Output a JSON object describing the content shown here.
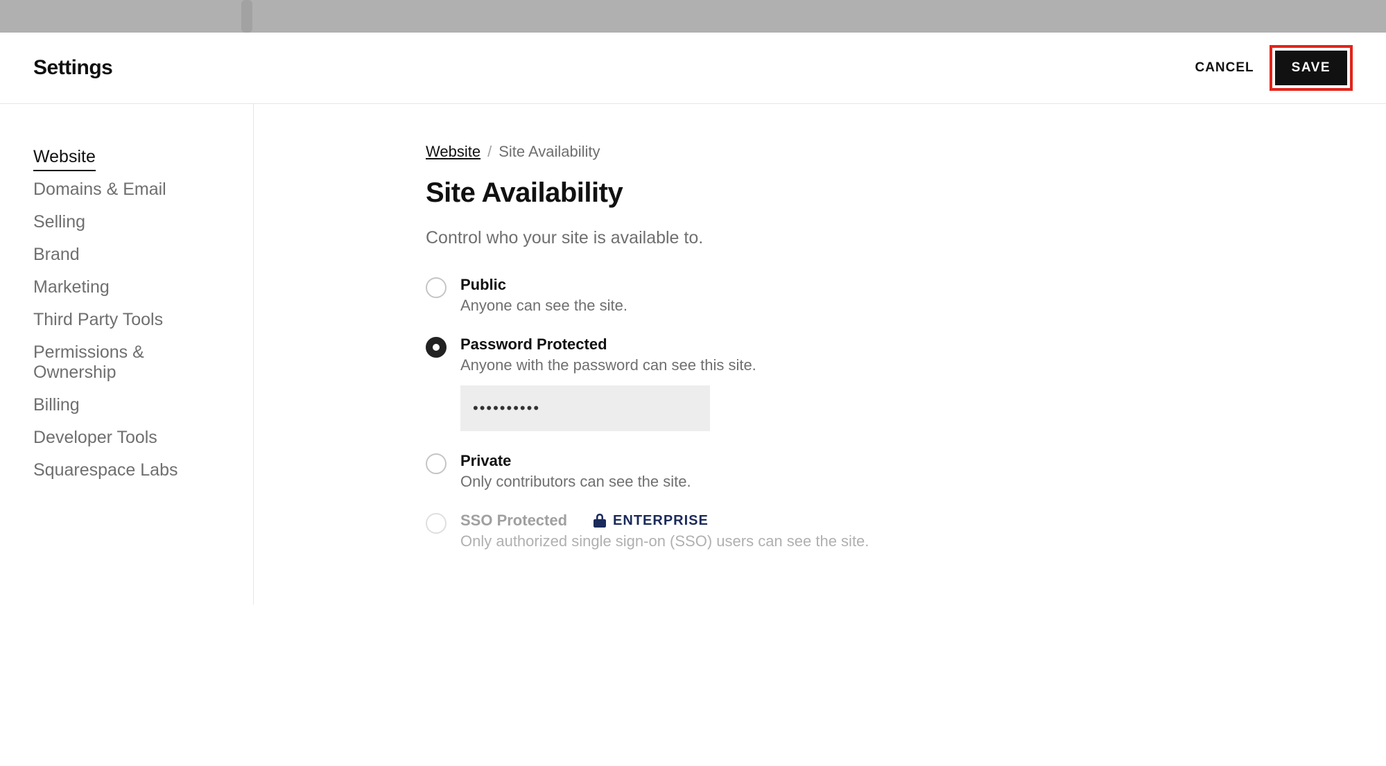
{
  "header": {
    "title": "Settings",
    "cancel_label": "CANCEL",
    "save_label": "SAVE"
  },
  "sidebar": {
    "items": [
      {
        "label": "Website",
        "active": true
      },
      {
        "label": "Domains & Email",
        "active": false
      },
      {
        "label": "Selling",
        "active": false
      },
      {
        "label": "Brand",
        "active": false
      },
      {
        "label": "Marketing",
        "active": false
      },
      {
        "label": "Third Party Tools",
        "active": false
      },
      {
        "label": "Permissions & Ownership",
        "active": false
      },
      {
        "label": "Billing",
        "active": false
      },
      {
        "label": "Developer Tools",
        "active": false
      },
      {
        "label": "Squarespace Labs",
        "active": false
      }
    ]
  },
  "breadcrumb": {
    "root": "Website",
    "separator": "/",
    "current": "Site Availability"
  },
  "page": {
    "title": "Site Availability",
    "description": "Control who your site is available to."
  },
  "options": [
    {
      "key": "public",
      "title": "Public",
      "description": "Anyone can see the site.",
      "selected": false,
      "disabled": false
    },
    {
      "key": "password",
      "title": "Password Protected",
      "description": "Anyone with the password can see this site.",
      "selected": true,
      "disabled": false,
      "password_value": "••••••••••"
    },
    {
      "key": "private",
      "title": "Private",
      "description": "Only contributors can see the site.",
      "selected": false,
      "disabled": false
    },
    {
      "key": "sso",
      "title": "SSO Protected",
      "description": "Only authorized single sign-on (SSO) users can see the site.",
      "selected": false,
      "disabled": true,
      "badge": "ENTERPRISE"
    }
  ],
  "colors": {
    "highlight": "#e2231a",
    "enterprise": "#1a2a5a"
  }
}
